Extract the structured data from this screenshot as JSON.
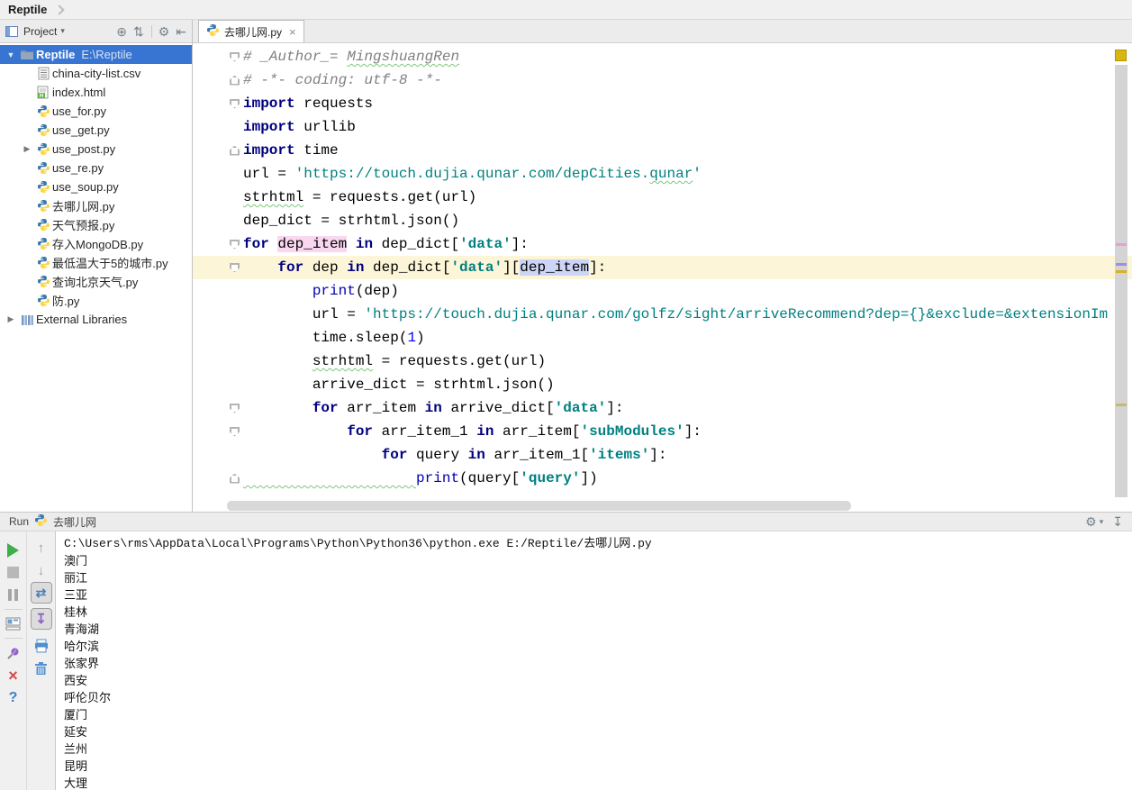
{
  "window": {
    "title": "Reptile"
  },
  "icons": {
    "dropdown": "▾",
    "locate": "⊕",
    "collapse_all": "⇅",
    "gear": "⚙",
    "hide_left": "⇤",
    "tab_close": "×",
    "tree_expanded": "▼",
    "tree_collapsed": "▶",
    "up_arrow": "↑",
    "down_arrow": "↓",
    "soft_wrap": "⇄",
    "scroll_end": "↧",
    "close_x": "×",
    "help": "?",
    "hide_down": "↧"
  },
  "project_panel": {
    "header_label": "Project",
    "tree": [
      {
        "label": "Reptile",
        "suffix": "E:\\Reptile",
        "icon": "folder",
        "indent": 0,
        "arrow": "expanded",
        "selected": true,
        "bold": true
      },
      {
        "label": "china-city-list.csv",
        "icon": "csv",
        "indent": 1
      },
      {
        "label": "index.html",
        "icon": "html",
        "indent": 1
      },
      {
        "label": "use_for.py",
        "icon": "python",
        "indent": 1
      },
      {
        "label": "use_get.py",
        "icon": "python",
        "indent": 1
      },
      {
        "label": "use_post.py",
        "icon": "python",
        "indent": 1,
        "arrow": "collapsed"
      },
      {
        "label": "use_re.py",
        "icon": "python",
        "indent": 1
      },
      {
        "label": "use_soup.py",
        "icon": "python",
        "indent": 1
      },
      {
        "label": "去哪儿网.py",
        "icon": "python",
        "indent": 1
      },
      {
        "label": "天气预报.py",
        "icon": "python",
        "indent": 1
      },
      {
        "label": "存入MongoDB.py",
        "icon": "python",
        "indent": 1
      },
      {
        "label": "最低温大于5的城市.py",
        "icon": "python",
        "indent": 1
      },
      {
        "label": "查询北京天气.py",
        "icon": "python",
        "indent": 1
      },
      {
        "label": "防.py",
        "icon": "python",
        "indent": 1
      },
      {
        "label": "External Libraries",
        "icon": "libs",
        "indent": 0,
        "arrow": "collapsed"
      }
    ]
  },
  "editor": {
    "tab_label": "去哪儿网.py",
    "lines": [
      {
        "fold": "d",
        "seg": [
          [
            "c",
            "# _Author_= "
          ],
          [
            "cw",
            "MingshuangRen"
          ]
        ]
      },
      {
        "fold": "u",
        "seg": [
          [
            "c",
            "# -*- coding: utf-8 -*-"
          ]
        ]
      },
      {
        "fold": "d",
        "seg": [
          [
            "k",
            "import"
          ],
          [
            "",
            " requests"
          ]
        ]
      },
      {
        "fold": "",
        "seg": [
          [
            "k",
            "import"
          ],
          [
            "",
            " urllib"
          ]
        ]
      },
      {
        "fold": "u",
        "seg": [
          [
            "k",
            "import"
          ],
          [
            "",
            " time"
          ]
        ]
      },
      {
        "fold": "",
        "seg": [
          [
            "",
            "url = "
          ],
          [
            "s",
            "'https://touch.dujia.qunar.com/depCities."
          ],
          [
            "sw",
            "qunar"
          ],
          [
            "s",
            "'"
          ]
        ]
      },
      {
        "fold": "",
        "seg": [
          [
            "w",
            "strhtml"
          ],
          [
            "",
            " = requests.get(url)"
          ]
        ]
      },
      {
        "fold": "",
        "seg": [
          [
            "",
            "dep_dict = strhtml.json()"
          ]
        ]
      },
      {
        "fold": "d",
        "seg": [
          [
            "k",
            "for"
          ],
          [
            "",
            " "
          ],
          [
            "hp",
            "dep_item"
          ],
          [
            "",
            " "
          ],
          [
            "k",
            "in"
          ],
          [
            "",
            " dep_dict["
          ],
          [
            "sb",
            "'data'"
          ],
          [
            "",
            "]:"
          ]
        ]
      },
      {
        "fold": "d",
        "cur": true,
        "seg": [
          [
            "",
            "    "
          ],
          [
            "k",
            "for"
          ],
          [
            "",
            " dep "
          ],
          [
            "k",
            "in"
          ],
          [
            "",
            " dep_dict["
          ],
          [
            "sb",
            "'data'"
          ],
          [
            "",
            "]["
          ],
          [
            "hb",
            "dep_item"
          ],
          [
            "",
            "]:"
          ]
        ]
      },
      {
        "fold": "",
        "seg": [
          [
            "",
            "        "
          ],
          [
            "f",
            "print"
          ],
          [
            "",
            "(dep)"
          ]
        ]
      },
      {
        "fold": "",
        "seg": [
          [
            "",
            "        url = "
          ],
          [
            "s",
            "'https://touch.dujia.qunar.com/golfz/sight/arriveRecommend?dep={}&exclude=&extensionIm"
          ]
        ]
      },
      {
        "fold": "",
        "seg": [
          [
            "",
            "        time.sleep("
          ],
          [
            "n",
            "1"
          ],
          [
            "",
            ")"
          ]
        ]
      },
      {
        "fold": "",
        "seg": [
          [
            "",
            "        "
          ],
          [
            "w",
            "strhtml"
          ],
          [
            "",
            " = requests.get(url)"
          ]
        ]
      },
      {
        "fold": "",
        "seg": [
          [
            "",
            "        arrive_dict = strhtml.json()"
          ]
        ]
      },
      {
        "fold": "d",
        "seg": [
          [
            "",
            "        "
          ],
          [
            "k",
            "for"
          ],
          [
            "",
            " arr_item "
          ],
          [
            "k",
            "in"
          ],
          [
            "",
            " arrive_dict["
          ],
          [
            "sb",
            "'data'"
          ],
          [
            "",
            "]:"
          ]
        ]
      },
      {
        "fold": "d",
        "seg": [
          [
            "",
            "            "
          ],
          [
            "k",
            "for"
          ],
          [
            "",
            " arr_item_1 "
          ],
          [
            "k",
            "in"
          ],
          [
            "",
            " arr_item["
          ],
          [
            "sb",
            "'subModules'"
          ],
          [
            "",
            "]:"
          ]
        ]
      },
      {
        "fold": "",
        "seg": [
          [
            "",
            "                "
          ],
          [
            "k",
            "for"
          ],
          [
            "",
            " query "
          ],
          [
            "k",
            "in"
          ],
          [
            "",
            " arr_item_1["
          ],
          [
            "sb",
            "'items'"
          ],
          [
            "",
            "]:"
          ]
        ]
      },
      {
        "fold": "u",
        "seg": [
          [
            "w",
            "                    "
          ],
          [
            "f",
            "print"
          ],
          [
            "",
            "(query["
          ],
          [
            "sb",
            "'query'"
          ],
          [
            "",
            "])"
          ]
        ]
      }
    ]
  },
  "run_panel": {
    "title": "Run",
    "tab_label": "去哪儿网",
    "console": {
      "command": "C:\\Users\\rms\\AppData\\Local\\Programs\\Python\\Python36\\python.exe E:/Reptile/去哪儿网.py",
      "output": [
        "澳门",
        "丽江",
        "三亚",
        "桂林",
        "青海湖",
        "哈尔滨",
        "张家界",
        "西安",
        "呼伦贝尔",
        "厦门",
        "延安",
        "兰州",
        "昆明",
        "大理"
      ]
    }
  },
  "colors": {
    "selection_blue": "#3875d2",
    "current_line": "#fcf5d8",
    "keyword": "#000080",
    "string": "#008080",
    "comment": "#808080",
    "write_usage_highlight": "#f9d8ef",
    "read_usage_highlight": "#ccd5f5",
    "warn_stripe": "#d9b712"
  }
}
